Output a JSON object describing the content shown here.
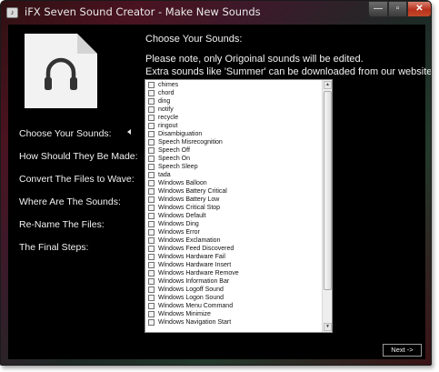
{
  "window": {
    "title": "iFX Seven Sound Creator - Make New Sounds",
    "controls": {
      "minimize": "—",
      "maximize": "▫",
      "close": "✕"
    }
  },
  "logo": {
    "icon": "headphones-icon"
  },
  "nav": {
    "items": [
      {
        "label": "Choose Your Sounds:",
        "active": true
      },
      {
        "label": "How Should They Be Made:"
      },
      {
        "label": "Convert The Files to Wave:"
      },
      {
        "label": "Where Are The Sounds:"
      },
      {
        "label": "Re-Name The Files:"
      },
      {
        "label": "The Final Steps:"
      }
    ]
  },
  "main": {
    "heading": "Choose Your Sounds:",
    "note_line1": "Please note, only Origoinal sounds will be edited.",
    "note_line2": "Extra sounds like 'Summer' can be downloaded from our website.",
    "sounds": [
      "chimes",
      "chord",
      "ding",
      "notify",
      "recycle",
      "ringout",
      "Disambiguation",
      "Speech Misrecognition",
      "Speech Off",
      "Speech On",
      "Speech Sleep",
      "tada",
      "Windows Balloon",
      "Windows Battery Critical",
      "Windows Battery Low",
      "Windows Critical Stop",
      "Windows Default",
      "Windows Ding",
      "Windows Error",
      "Windows Exclamation",
      "Windows Feed Discovered",
      "Windows Hardware Fail",
      "Windows Hardware Insert",
      "Windows Hardware Remove",
      "Windows Information Bar",
      "Windows Logoff Sound",
      "Windows Logon Sound",
      "Windows Menu Command",
      "Windows Minimize",
      "Windows Navigation Start"
    ]
  },
  "footer": {
    "next_label": "Next ->"
  }
}
